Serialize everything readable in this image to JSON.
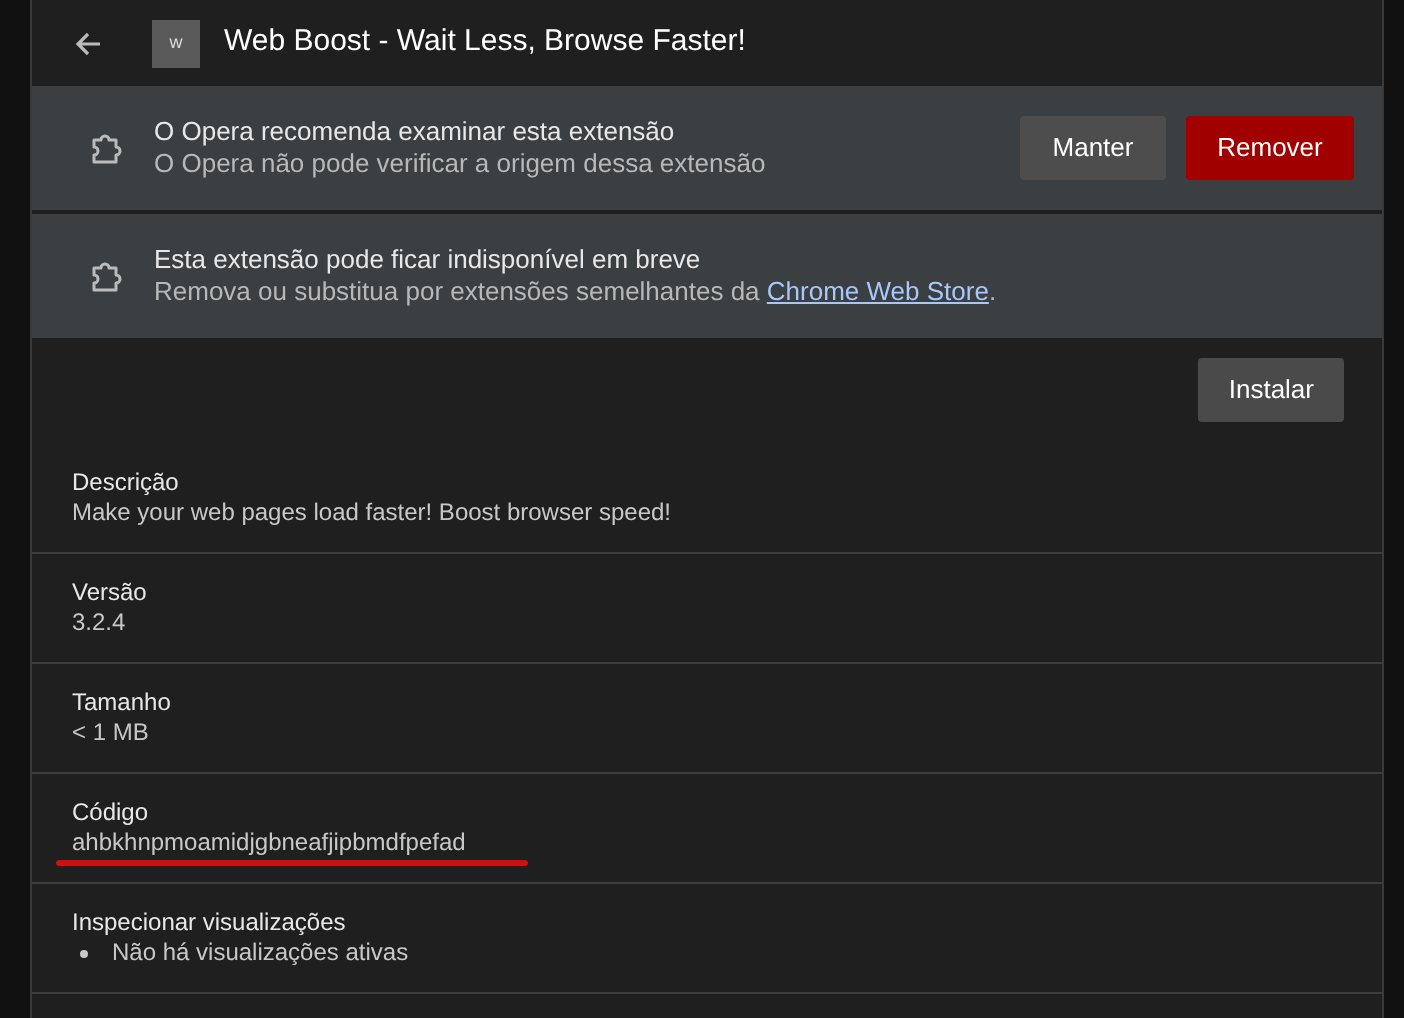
{
  "header": {
    "title": "Web Boost - Wait Less, Browse Faster!",
    "icon_letter": "w"
  },
  "warnings": [
    {
      "title": "O Opera recomenda examinar esta extensão",
      "text": "O Opera não pode verificar a origem dessa extensão",
      "buttons": [
        {
          "label": "Manter",
          "kind": "secondary"
        },
        {
          "label": "Remover",
          "kind": "danger"
        }
      ]
    },
    {
      "title": "Esta extensão pode ficar indisponível em breve",
      "text": "Remova ou substitua por extensões semelhantes da ",
      "link": "Chrome Web Store",
      "after": "."
    }
  ],
  "install_button": "Instalar",
  "details": [
    {
      "label": "Descrição",
      "value": "Make your web pages load faster! Boost browser speed!"
    },
    {
      "label": "Versão",
      "value": "3.2.4"
    },
    {
      "label": "Tamanho",
      "value": "< 1 MB"
    },
    {
      "label": "Código",
      "value": "ahbkhnpmoamidjgbneafjipbmdfpefad",
      "underlined": true
    },
    {
      "label": "Inspecionar visualizações",
      "bullets": [
        "Não há visualizações ativas"
      ]
    }
  ]
}
